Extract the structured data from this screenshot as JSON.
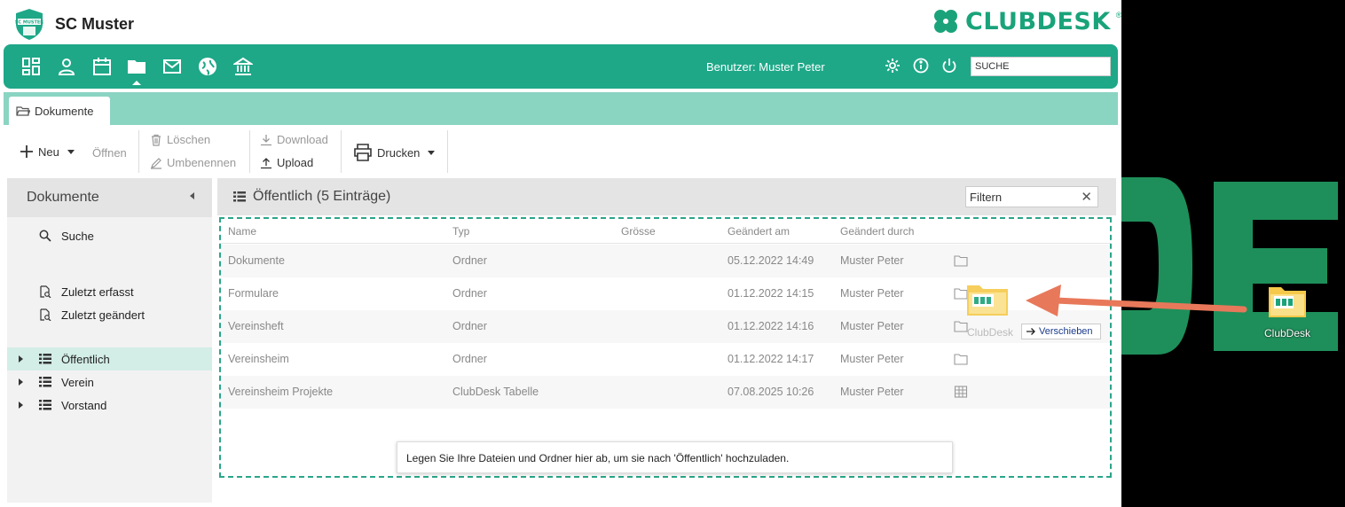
{
  "header": {
    "club_name": "SC Muster",
    "brand": "CLUBDESK",
    "brand_reg": "®"
  },
  "navbar": {
    "icons": [
      "dashboard-icon",
      "person-icon",
      "calendar-icon",
      "folder-icon",
      "mail-icon",
      "globe-icon",
      "bank-icon"
    ],
    "active": "folder-icon",
    "user_label": "Benutzer: Muster Peter",
    "right_icons": [
      "gear-icon",
      "info-icon",
      "power-icon"
    ],
    "search_value": "SUCHE"
  },
  "tabs": [
    {
      "label": "Dokumente"
    }
  ],
  "toolbar": {
    "new_label": "Neu",
    "open_label": "Öffnen",
    "delete_label": "Löschen",
    "rename_label": "Umbenennen",
    "download_label": "Download",
    "upload_label": "Upload",
    "print_label": "Drucken"
  },
  "sidebar": {
    "title": "Dokumente",
    "search_label": "Suche",
    "recent_added": "Zuletzt erfasst",
    "recent_changed": "Zuletzt geändert",
    "folders": [
      {
        "label": "Öffentlich",
        "active": true
      },
      {
        "label": "Verein",
        "active": false
      },
      {
        "label": "Vorstand",
        "active": false
      }
    ]
  },
  "main": {
    "title": "Öffentlich (5 Einträge)",
    "filter_placeholder": "Filtern",
    "columns": [
      "Name",
      "Typ",
      "Grösse",
      "Geändert am",
      "Geändert durch"
    ],
    "rows": [
      {
        "name": "Dokumente",
        "type": "Ordner",
        "size": "",
        "changed": "05.12.2022 14:49",
        "by": "Muster Peter",
        "icon": "folder-icon"
      },
      {
        "name": "Formulare",
        "type": "Ordner",
        "size": "",
        "changed": "01.12.2022 14:15",
        "by": "Muster Peter",
        "icon": "folder-icon"
      },
      {
        "name": "Vereinsheft",
        "type": "Ordner",
        "size": "",
        "changed": "01.12.2022 14:16",
        "by": "Muster Peter",
        "icon": "folder-icon"
      },
      {
        "name": "Vereinsheim",
        "type": "Ordner",
        "size": "",
        "changed": "01.12.2022 14:17",
        "by": "Muster Peter",
        "icon": "folder-icon"
      },
      {
        "name": "Vereinsheim Projekte",
        "type": "ClubDesk Tabelle",
        "size": "",
        "changed": "07.08.2025 10:26",
        "by": "Muster Peter",
        "icon": "table-icon"
      }
    ],
    "drop_hint": "Legen Sie Ihre Dateien und Ordner hier ab, um sie nach 'Öffentlich' hochzuladen."
  },
  "drag": {
    "ghost_label": "ClubDesk",
    "move_label": "Verschieben"
  },
  "desktop": {
    "icon_label": "ClubDesk"
  },
  "colors": {
    "brand_green": "#1ea888",
    "tab_strip": "#8ad4c2",
    "arrow": "#e8785a"
  }
}
